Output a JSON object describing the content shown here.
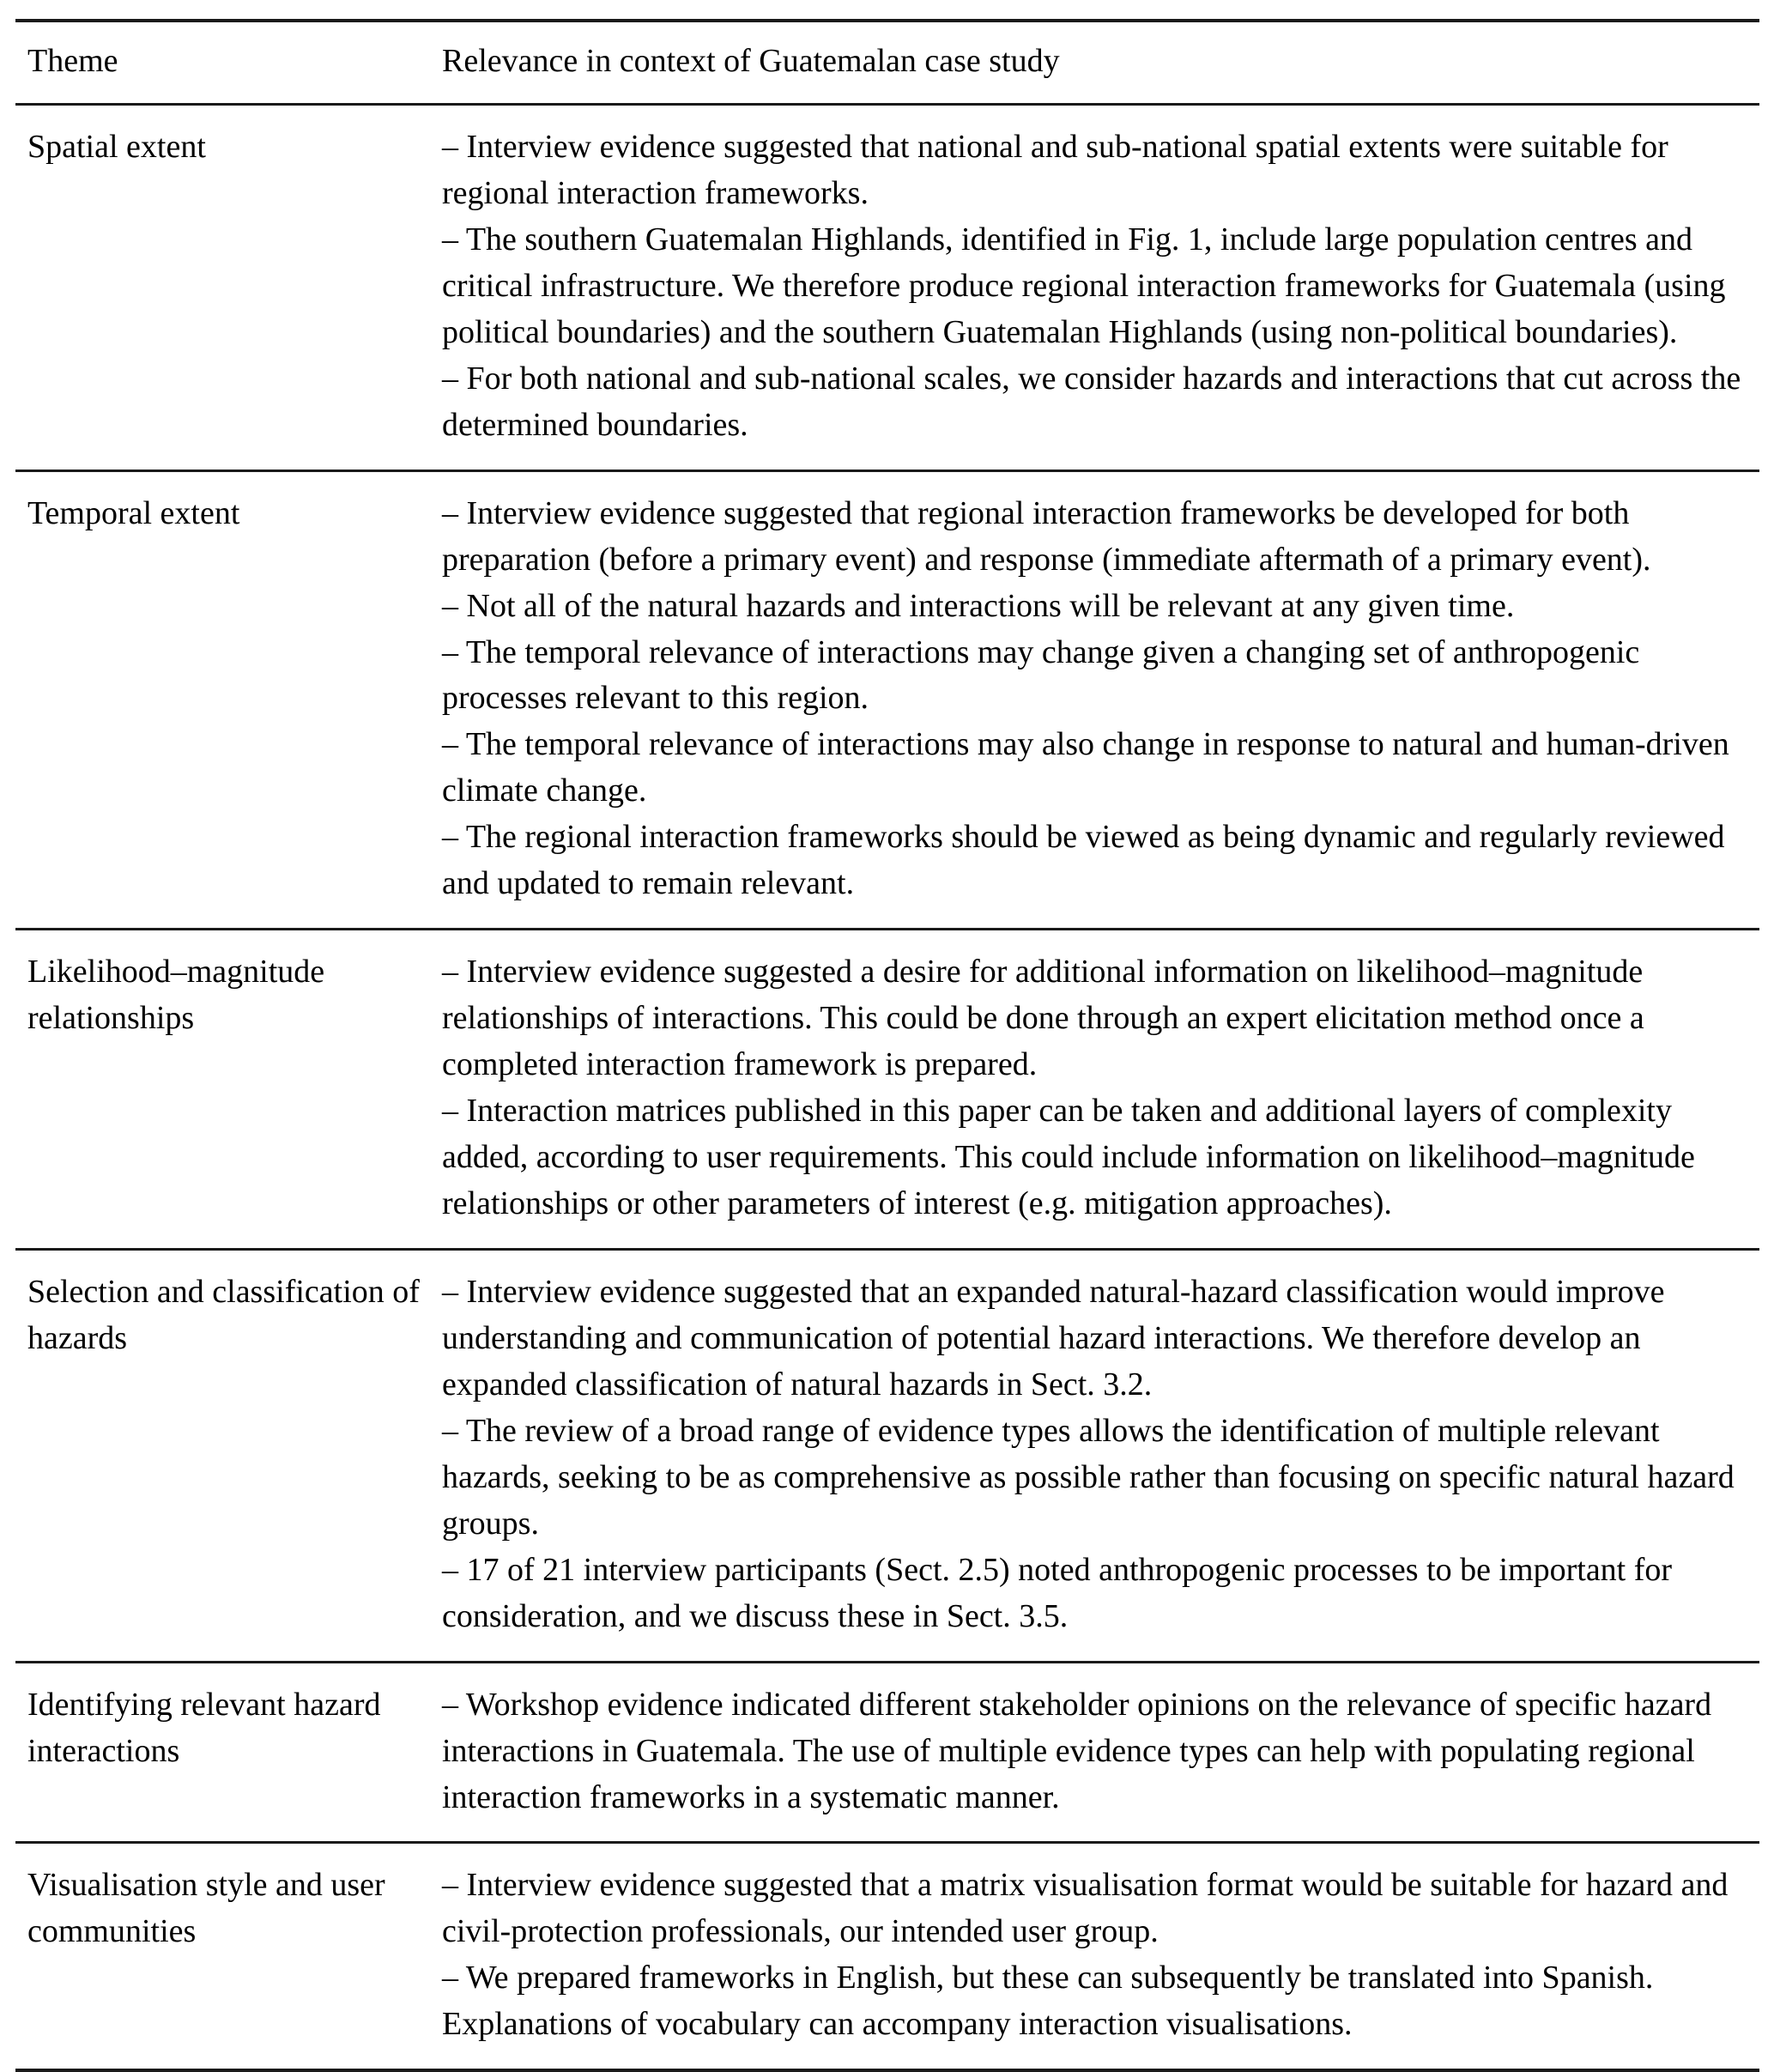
{
  "table": {
    "columns": [
      {
        "key": "theme",
        "header": "Theme"
      },
      {
        "key": "relevance",
        "header": "Relevance in context of Guatemalan case study"
      }
    ],
    "rows": [
      {
        "theme": "Spatial extent",
        "bullets": [
          "– Interview evidence suggested that national and sub-national spatial extents were suitable for regional interaction frameworks.",
          "– The southern Guatemalan Highlands, identified in Fig. 1, include large population centres and critical infrastructure. We therefore produce regional interaction frameworks for Guatemala (using political boundaries) and the southern Guatemalan Highlands (using non-political boundaries).",
          "– For both national and sub-national scales, we consider hazards and interactions that cut across the determined boundaries."
        ]
      },
      {
        "theme": "Temporal extent",
        "bullets": [
          "– Interview evidence suggested that regional interaction frameworks be developed for both preparation (before a primary event) and response (immediate aftermath of a primary event).",
          "– Not all of the natural hazards and interactions will be relevant at any given time.",
          "– The temporal relevance of interactions may change given a changing set of anthropogenic processes relevant to this region.",
          "– The temporal relevance of interactions may also change in response to natural and human-driven climate change.",
          "– The regional interaction frameworks should be viewed as being dynamic and regularly reviewed and updated to remain relevant."
        ]
      },
      {
        "theme": "Likelihood–magnitude relationships",
        "bullets": [
          "– Interview evidence suggested a desire for additional information on likelihood–magnitude relationships of interactions. This could be done through an expert elicitation method once a completed interaction framework is prepared.",
          "– Interaction matrices published in this paper can be taken and additional layers of complexity added, according to user requirements. This could include information on likelihood–magnitude relationships or other parameters of interest (e.g. mitigation approaches)."
        ]
      },
      {
        "theme": "Selection and classification of hazards",
        "bullets": [
          "– Interview evidence suggested that an expanded natural-hazard classification would improve understanding and communication of potential hazard interactions. We therefore develop an expanded classification of natural hazards in Sect. 3.2.",
          "– The review of a broad range of evidence types allows the identification of multiple relevant hazards, seeking to be as comprehensive as possible rather than focusing on specific natural hazard groups.",
          "– 17 of 21 interview participants (Sect. 2.5) noted anthropogenic processes to be important for consideration, and we discuss these in Sect. 3.5."
        ]
      },
      {
        "theme": "Identifying relevant hazard interactions",
        "bullets": [
          "– Workshop evidence indicated different stakeholder opinions on the relevance of specific hazard interactions in Guatemala. The use of multiple evidence types can help with populating regional interaction frameworks in a systematic manner."
        ]
      },
      {
        "theme": "Visualisation style and user communities",
        "bullets": [
          "– Interview evidence suggested that a matrix visualisation format would be suitable for hazard and civil-protection professionals, our intended user group.",
          "– We prepared frameworks in English, but these can subsequently be translated into Spanish. Explanations of vocabulary can accompany interaction visualisations."
        ]
      }
    ]
  }
}
